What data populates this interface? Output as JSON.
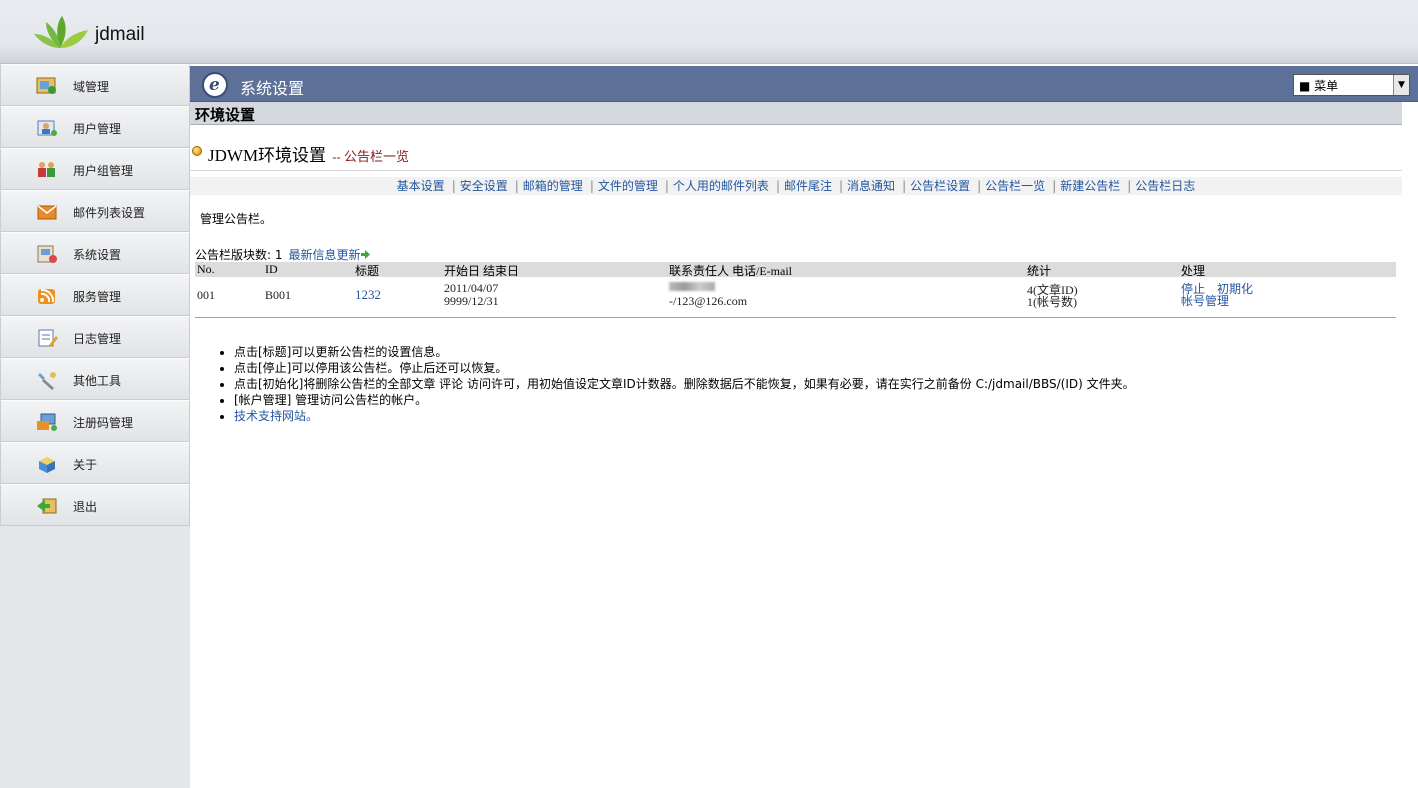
{
  "app": {
    "name": "jdmail"
  },
  "sidebar": {
    "items": [
      {
        "label": "域管理",
        "icon": "domain-icon"
      },
      {
        "label": "用户管理",
        "icon": "user-icon"
      },
      {
        "label": "用户组管理",
        "icon": "user-group-icon"
      },
      {
        "label": "邮件列表设置",
        "icon": "mailing-list-icon"
      },
      {
        "label": "系统设置",
        "icon": "system-settings-icon"
      },
      {
        "label": "服务管理",
        "icon": "service-icon"
      },
      {
        "label": "日志管理",
        "icon": "log-icon"
      },
      {
        "label": "其他工具",
        "icon": "tools-icon"
      },
      {
        "label": "注册码管理",
        "icon": "registration-code-icon"
      },
      {
        "label": "关于",
        "icon": "about-icon"
      },
      {
        "label": "退出",
        "icon": "logout-icon"
      }
    ]
  },
  "titlebar": {
    "title": "系统设置",
    "menu_select": "■ 菜单"
  },
  "section": {
    "title": "环境设置"
  },
  "subhead": {
    "title": "JDWM环境设置",
    "subtitle": "-- 公告栏一览"
  },
  "nav": {
    "links": [
      "基本设置",
      "安全设置",
      "邮箱的管理",
      "文件的管理",
      "个人用的邮件列表",
      "邮件尾注",
      "消息通知",
      "公告栏设置",
      "公告栏一览",
      "新建公告栏",
      "公告栏日志"
    ]
  },
  "description": "管理公告栏。",
  "count": {
    "label": "公告栏版块数: 1",
    "update_link": "最新信息更新"
  },
  "table": {
    "headers": {
      "no": "No.",
      "id": "ID",
      "title": "标题",
      "dates": "开始日 结束日",
      "contact": "联系责任人 电话/E-mail",
      "stats": "统计",
      "action": "处理"
    },
    "rows": [
      {
        "no": "001",
        "id": "B001",
        "title": "1232",
        "start": "2011/04/07",
        "end": "9999/12/31",
        "contact_email": "-/123@126.com",
        "stats_articles": "4(文章ID)",
        "stats_accounts": "1(帐号数)",
        "action_stop": "停止",
        "action_init": "初期化",
        "action_accounts": "帐号管理"
      }
    ]
  },
  "notes": [
    "点击[标题]可以更新公告栏的设置信息。",
    "点击[停止]可以停用该公告栏。停止后还可以恢复。",
    "点击[初始化]将删除公告栏的全部文章 评论 访问许可，用初始值设定文章ID计数器。删除数据后不能恢复，如果有必要，请在实行之前备份  C:/jdmail/BBS/(ID) 文件夹。",
    "[帐户管理] 管理访问公告栏的帐户。"
  ],
  "support_link": "技术支持网站。"
}
